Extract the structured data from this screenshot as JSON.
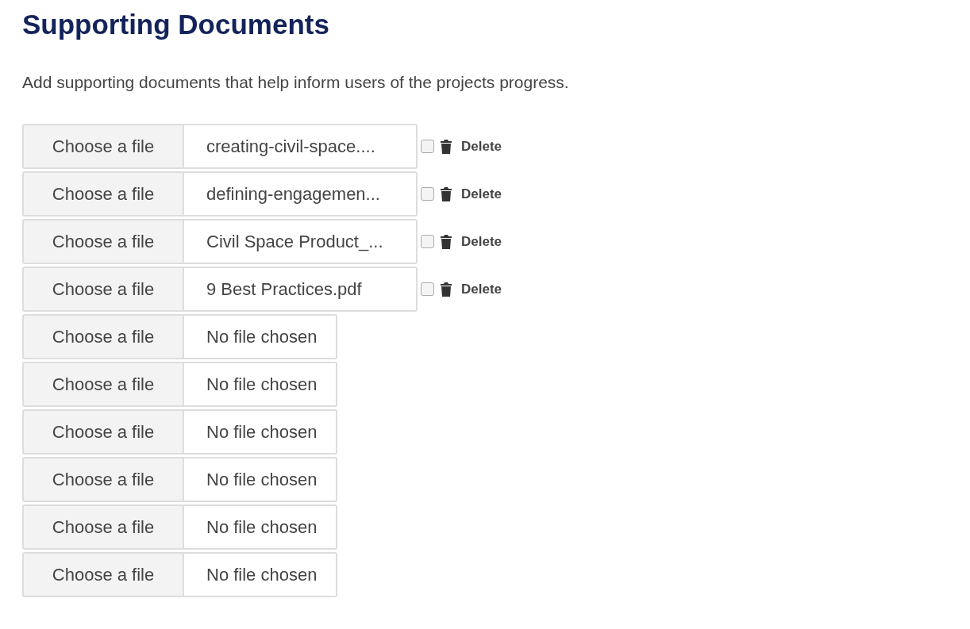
{
  "title": "Supporting Documents",
  "description": "Add supporting documents that help inform users of the projects progress.",
  "files": [
    {
      "kind": "chosen",
      "button": "Choose a file",
      "file_name": "creating-civil-space....",
      "delete_checked": false,
      "delete_label": "Delete"
    },
    {
      "kind": "chosen",
      "button": "Choose a file",
      "file_name": "defining-engagemen...",
      "delete_checked": false,
      "delete_label": "Delete"
    },
    {
      "kind": "chosen",
      "button": "Choose a file",
      "file_name": "Civil Space Product_...",
      "delete_checked": false,
      "delete_label": "Delete"
    },
    {
      "kind": "chosen",
      "button": "Choose a file",
      "file_name": "9 Best Practices.pdf",
      "delete_checked": false,
      "delete_label": "Delete"
    },
    {
      "kind": "empty",
      "button": "Choose a file",
      "file_name": "No file chosen"
    },
    {
      "kind": "empty",
      "button": "Choose a file",
      "file_name": "No file chosen"
    },
    {
      "kind": "empty",
      "button": "Choose a file",
      "file_name": "No file chosen"
    },
    {
      "kind": "empty",
      "button": "Choose a file",
      "file_name": "No file chosen"
    },
    {
      "kind": "empty",
      "button": "Choose a file",
      "file_name": "No file chosen"
    },
    {
      "kind": "empty",
      "button": "Choose a file",
      "file_name": "No file chosen"
    }
  ]
}
